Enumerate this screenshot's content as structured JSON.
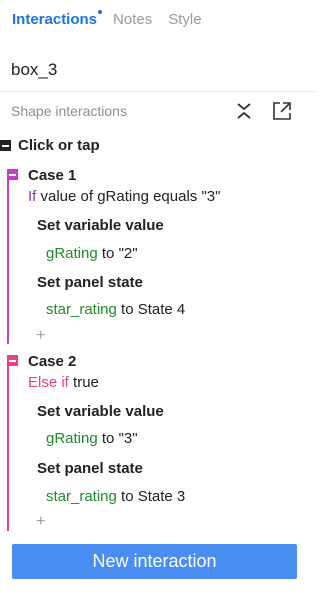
{
  "tabs": [
    {
      "label": "Interactions",
      "active": true
    },
    {
      "label": "Notes",
      "active": false
    },
    {
      "label": "Style",
      "active": false
    }
  ],
  "widget_name": "box_3",
  "section_title": "Shape interactions",
  "event": {
    "label": "Click or tap"
  },
  "cases": [
    {
      "title": "Case 1",
      "condition_keyword": "If",
      "condition_text": " value of gRating equals \"3\"",
      "actions": [
        {
          "title": "Set variable value",
          "target": "gRating",
          "connector": " to ",
          "value": "\"2\""
        },
        {
          "title": "Set panel state",
          "target": "star_rating",
          "connector": " to ",
          "value": "State 4"
        }
      ],
      "add_label": "+"
    },
    {
      "title": "Case 2",
      "condition_keyword": "Else if",
      "condition_text": " true",
      "actions": [
        {
          "title": "Set variable value",
          "target": "gRating",
          "connector": " to ",
          "value": "\"3\""
        },
        {
          "title": "Set panel state",
          "target": "star_rating",
          "connector": " to ",
          "value": "State 3"
        }
      ],
      "add_label": "+"
    }
  ],
  "new_interaction_label": "New interaction",
  "colors": {
    "accent": "#1a73e8",
    "button": "#4a8df0",
    "case1": "#c63cc9",
    "case2": "#e8408e",
    "variable_green": "#1e8c2a"
  }
}
